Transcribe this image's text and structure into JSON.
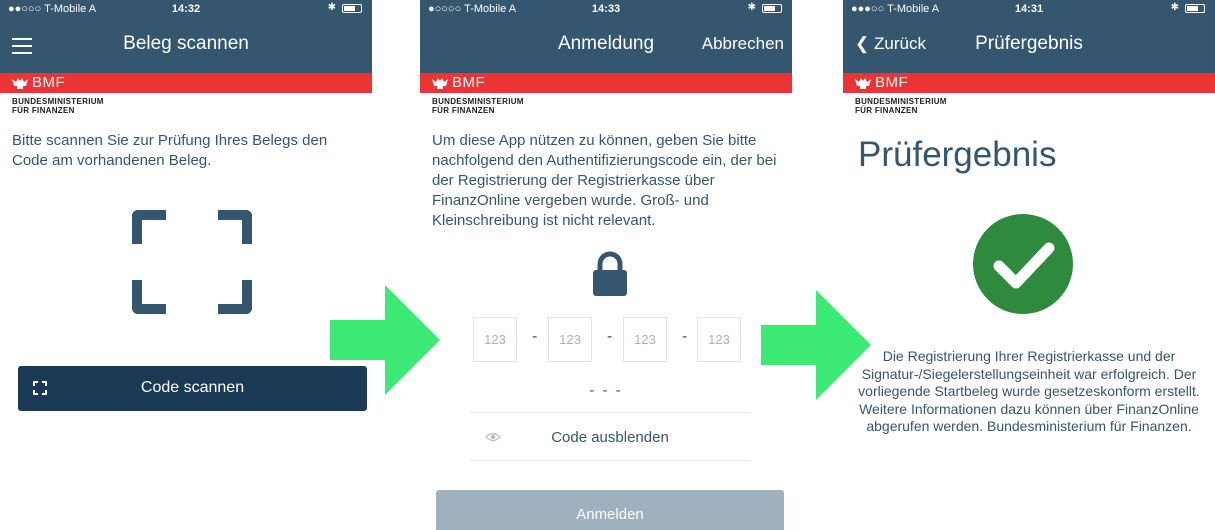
{
  "screens": [
    {
      "status": {
        "carrier": "●●○○○ T-Mobile A",
        "time": "14:32"
      },
      "nav": {
        "title": "Beleg scannen"
      },
      "brand": {
        "bmf": "BMF",
        "ministry_line1": "BUNDESMINISTERIUM",
        "ministry_line2": "FÜR FINANZEN"
      },
      "instruction": "Bitte scannen Sie zur Prüfung Ihres Belegs den Code am vorhandenen Beleg.",
      "scan_button": "Code scannen"
    },
    {
      "status": {
        "carrier": "●○○○○ T-Mobile A",
        "time": "14:33"
      },
      "nav": {
        "title": "Anmeldung",
        "right": "Abbrechen"
      },
      "brand": {
        "bmf": "BMF",
        "ministry_line1": "BUNDESMINISTERIUM",
        "ministry_line2": "FÜR FINANZEN"
      },
      "instruction": "Um diese App nützen zu können, geben Sie bitte nachfolgend den Authentifizierungscode ein, der bei der Registrierung der Registrierkasse über FinanzOnline vergeben wurde. Groß- und Kleinschreibung ist nicht relevant.",
      "code_fields": [
        "123",
        "123",
        "123",
        "123"
      ],
      "separator": "-",
      "code_preview": "- - -",
      "toggle_label": "Code ausblenden",
      "login_button": "Anmelden"
    },
    {
      "status": {
        "carrier": "●●●○○ T-Mobile A",
        "time": "14:31"
      },
      "nav": {
        "title": "Prüfergebnis",
        "back": "Zurück"
      },
      "brand": {
        "bmf": "BMF",
        "ministry_line1": "BUNDESMINISTERIUM",
        "ministry_line2": "FÜR FINANZEN"
      },
      "heading": "Prüfergebnis",
      "result_text": "Die Registrierung Ihrer Registrierkasse und der Signatur-/Siegelerstellungseinheit war erfolgreich. Der vorliegende Startbeleg wurde gesetzeskonform erstellt. Weitere Informationen dazu können über FinanzOnline abgerufen werden. Bundesministerium für Finanzen."
    }
  ],
  "colors": {
    "nav": "#34566f",
    "bmf_red": "#ec3336",
    "button_dark": "#1b3a55",
    "button_disabled": "#9fb1be",
    "success_green": "#2e8b3e",
    "arrow_green": "#2ee86a"
  },
  "icons": [
    "menu-icon",
    "scan-frame-icon",
    "lock-icon",
    "eye-icon",
    "check-icon",
    "chevron-left-icon",
    "arrow-right-icon"
  ]
}
